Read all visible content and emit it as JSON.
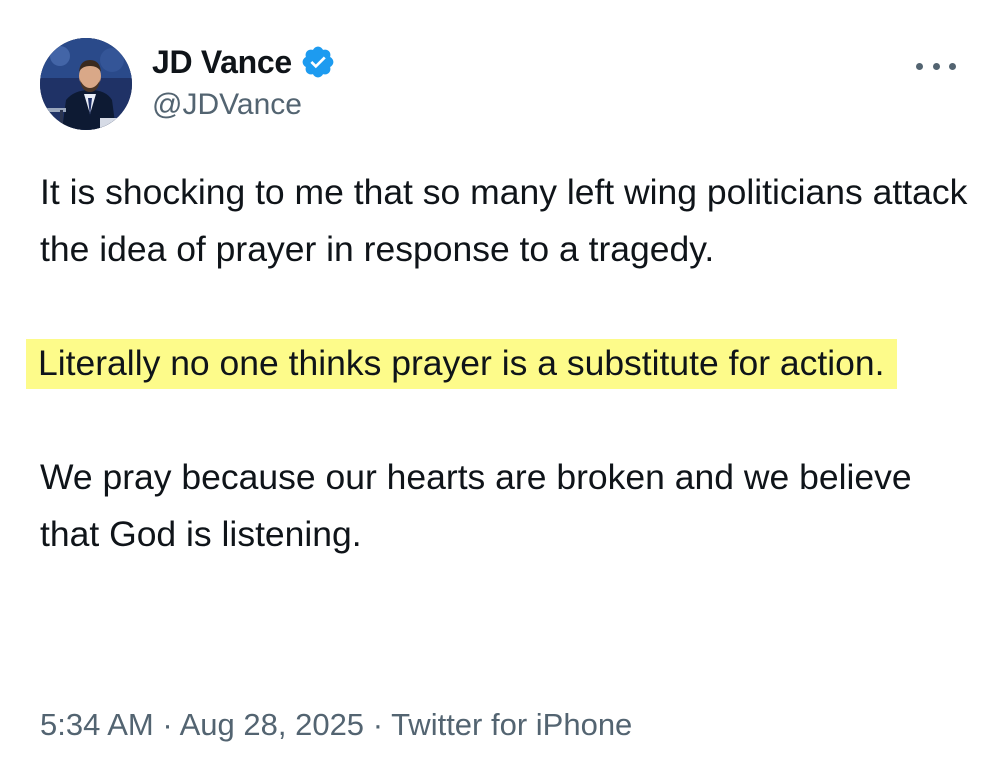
{
  "author": {
    "display_name": "JD Vance",
    "handle": "@JDVance",
    "verified": true,
    "verified_color": "#1d9bf0",
    "avatar_icon": "profile-photo"
  },
  "tweet": {
    "paragraph_1": "It is shocking to me that so many left wing politicians attack the idea of prayer in response to a tragedy.",
    "paragraph_2": "Literally no one thinks prayer is a substitute for action.",
    "paragraph_3": "We pray because our hearts are broken and we believe that God is listening.",
    "highlight_color": "#fdfb8a"
  },
  "meta": {
    "time": "5:34 AM",
    "separator": "·",
    "date": "Aug 28, 2025",
    "source": "Twitter for iPhone"
  },
  "menu": {
    "more_icon": "more-horizontal-icon"
  }
}
